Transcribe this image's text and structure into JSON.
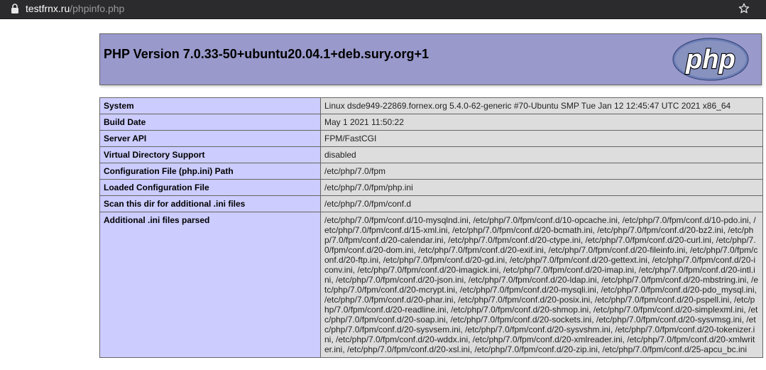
{
  "browser": {
    "url_host": "testfrnx.ru",
    "url_path": "/phpinfo.php",
    "icons": [
      "lock-icon",
      "bookmark-star-icon"
    ]
  },
  "header": {
    "title": "PHP Version 7.0.33-50+ubuntu20.04.1+deb.sury.org+1",
    "logo_text": "php"
  },
  "colors": {
    "header_bg": "#9999cc",
    "key_cell_bg": "#ccccff",
    "value_cell_bg": "#dddddd",
    "browser_bar": "#2b2b2d"
  },
  "rows": [
    {
      "key": "System",
      "value": "Linux dsde949-22869.fornex.org 5.4.0-62-generic #70-Ubuntu SMP Tue Jan 12 12:45:47 UTC 2021 x86_64"
    },
    {
      "key": "Build Date",
      "value": "May 1 2021 11:50:22"
    },
    {
      "key": "Server API",
      "value": "FPM/FastCGI"
    },
    {
      "key": "Virtual Directory Support",
      "value": "disabled"
    },
    {
      "key": "Configuration File (php.ini) Path",
      "value": "/etc/php/7.0/fpm"
    },
    {
      "key": "Loaded Configuration File",
      "value": "/etc/php/7.0/fpm/php.ini"
    },
    {
      "key": "Scan this dir for additional .ini files",
      "value": "/etc/php/7.0/fpm/conf.d"
    },
    {
      "key": "Additional .ini files parsed",
      "value": "/etc/php/7.0/fpm/conf.d/10-mysqlnd.ini, /etc/php/7.0/fpm/conf.d/10-opcache.ini, /etc/php/7.0/fpm/conf.d/10-pdo.ini, /etc/php/7.0/fpm/conf.d/15-xml.ini, /etc/php/7.0/fpm/conf.d/20-bcmath.ini, /etc/php/7.0/fpm/conf.d/20-bz2.ini, /etc/php/7.0/fpm/conf.d/20-calendar.ini, /etc/php/7.0/fpm/conf.d/20-ctype.ini, /etc/php/7.0/fpm/conf.d/20-curl.ini, /etc/php/7.0/fpm/conf.d/20-dom.ini, /etc/php/7.0/fpm/conf.d/20-exif.ini, /etc/php/7.0/fpm/conf.d/20-fileinfo.ini, /etc/php/7.0/fpm/conf.d/20-ftp.ini, /etc/php/7.0/fpm/conf.d/20-gd.ini, /etc/php/7.0/fpm/conf.d/20-gettext.ini, /etc/php/7.0/fpm/conf.d/20-iconv.ini, /etc/php/7.0/fpm/conf.d/20-imagick.ini, /etc/php/7.0/fpm/conf.d/20-imap.ini, /etc/php/7.0/fpm/conf.d/20-intl.ini, /etc/php/7.0/fpm/conf.d/20-json.ini, /etc/php/7.0/fpm/conf.d/20-ldap.ini, /etc/php/7.0/fpm/conf.d/20-mbstring.ini, /etc/php/7.0/fpm/conf.d/20-mcrypt.ini, /etc/php/7.0/fpm/conf.d/20-mysqli.ini, /etc/php/7.0/fpm/conf.d/20-pdo_mysql.ini, /etc/php/7.0/fpm/conf.d/20-phar.ini, /etc/php/7.0/fpm/conf.d/20-posix.ini, /etc/php/7.0/fpm/conf.d/20-pspell.ini, /etc/php/7.0/fpm/conf.d/20-readline.ini, /etc/php/7.0/fpm/conf.d/20-shmop.ini, /etc/php/7.0/fpm/conf.d/20-simplexml.ini, /etc/php/7.0/fpm/conf.d/20-soap.ini, /etc/php/7.0/fpm/conf.d/20-sockets.ini, /etc/php/7.0/fpm/conf.d/20-sysvmsg.ini, /etc/php/7.0/fpm/conf.d/20-sysvsem.ini, /etc/php/7.0/fpm/conf.d/20-sysvshm.ini, /etc/php/7.0/fpm/conf.d/20-tokenizer.ini, /etc/php/7.0/fpm/conf.d/20-wddx.ini, /etc/php/7.0/fpm/conf.d/20-xmlreader.ini, /etc/php/7.0/fpm/conf.d/20-xmlwriter.ini, /etc/php/7.0/fpm/conf.d/20-xsl.ini, /etc/php/7.0/fpm/conf.d/20-zip.ini, /etc/php/7.0/fpm/conf.d/25-apcu_bc.ini"
    }
  ]
}
